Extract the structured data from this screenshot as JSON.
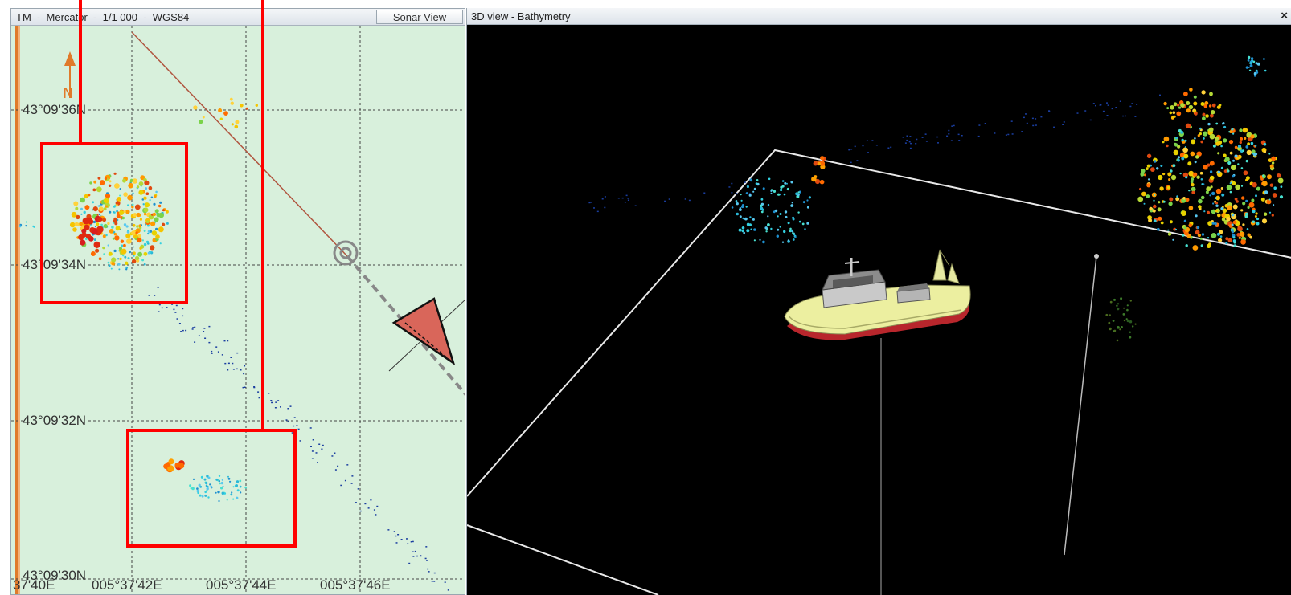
{
  "chart_pane": {
    "title": "TM  -  Mercator  -  1/1 000  -  WGS84",
    "tab_label": "Sonar View",
    "lat_labels": [
      "43°09'36N",
      "43°09'34N",
      "43°09'32N",
      "43°09'30N"
    ],
    "lon_labels": [
      "37'40E",
      "005°37'42E",
      "005°37'44E",
      "005°37'46E"
    ],
    "north_label": "N"
  },
  "view3d_pane": {
    "title": "3D view - Bathymetry",
    "close_label": "×"
  },
  "colors": {
    "chart_bg": "#d8f0dc",
    "annotation_red": "#ff0000",
    "route_line": "#b0553f",
    "vessel_triangle": "#d9665a",
    "grid_line": "#444444",
    "view3d_bg": "#000000",
    "ship_hull_red": "#b8262c",
    "ship_deck_yellow": "#ecefa0"
  }
}
